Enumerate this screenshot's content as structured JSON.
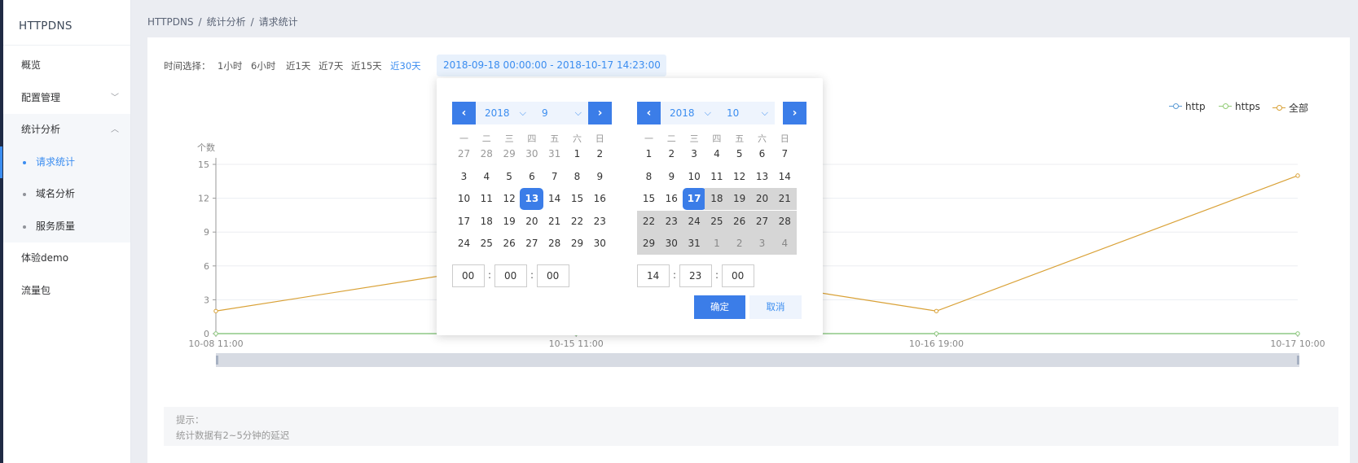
{
  "sidebar": {
    "brand": "HTTPDNS",
    "items": [
      {
        "label": "概览"
      },
      {
        "label": "配置管理"
      },
      {
        "label": "统计分析"
      }
    ],
    "sub_items": [
      {
        "label": "请求统计"
      },
      {
        "label": "域名分析"
      },
      {
        "label": "服务质量"
      }
    ],
    "items_after": [
      {
        "label": "体验demo"
      },
      {
        "label": "流量包"
      }
    ]
  },
  "breadcrumb": [
    "HTTPDNS",
    "/",
    "统计分析",
    "/",
    "请求统计"
  ],
  "filter": {
    "label": "时间选择：",
    "options": [
      "1小时",
      "6小时",
      "近1天",
      "近7天",
      "近15天",
      "近30天"
    ],
    "active_option": "近30天",
    "range_text": "2018-09-18 00:00:00 - 2018-10-17 14:23:00"
  },
  "chart_data": {
    "type": "line",
    "ylabel": "个数",
    "ylim": [
      0,
      15
    ],
    "yticks": [
      "0",
      "3",
      "6",
      "9",
      "12",
      "15"
    ],
    "x": [
      "10-08 11:00",
      "10-15 11:00",
      "10-16 19:00",
      "10-17 10:00"
    ],
    "x_frac": [
      0,
      0.333,
      0.666,
      1
    ],
    "grid": true,
    "legend_position": "top-right",
    "series": [
      {
        "name": "http",
        "color": "#5b9bd5",
        "values": [
          0,
          0,
          0,
          0
        ]
      },
      {
        "name": "https",
        "color": "#91cc75",
        "values": [
          0,
          0,
          0,
          0
        ]
      },
      {
        "name": "全部",
        "color": "#d9a136",
        "values": [
          2,
          7,
          2,
          14
        ]
      }
    ]
  },
  "datepicker": {
    "left": {
      "year": "2018",
      "month": "9",
      "days": [
        "27",
        "28",
        "29",
        "30",
        "31",
        "1",
        "2",
        "3",
        "4",
        "5",
        "6",
        "7",
        "8",
        "9",
        "10",
        "11",
        "12",
        "13",
        "14",
        "15",
        "16",
        "17",
        "18",
        "19",
        "20",
        "21",
        "22",
        "23",
        "24",
        "25",
        "26",
        "27",
        "28",
        "29",
        "30"
      ],
      "selected": "18",
      "time": [
        "00",
        "00",
        "00"
      ]
    },
    "right": {
      "year": "2018",
      "month": "10",
      "days": [
        "1",
        "2",
        "3",
        "4",
        "5",
        "6",
        "7",
        "8",
        "9",
        "10",
        "11",
        "12",
        "13",
        "14",
        "15",
        "16",
        "17",
        "18",
        "19",
        "20",
        "21",
        "22",
        "23",
        "24",
        "25",
        "26",
        "27",
        "28",
        "29",
        "30",
        "31",
        "1",
        "2",
        "3",
        "4"
      ],
      "selected": "17",
      "time": [
        "14",
        "23",
        "00"
      ]
    },
    "weekdays": [
      "一",
      "二",
      "三",
      "四",
      "五",
      "六",
      "日"
    ],
    "prev_icon": "‹",
    "next_icon": "›",
    "dropdown_icon": "⌵",
    "confirm_label": "确定",
    "cancel_label": "取消"
  },
  "tip": {
    "title": "提示：",
    "text": "统计数据有2~5分钟的延迟"
  }
}
